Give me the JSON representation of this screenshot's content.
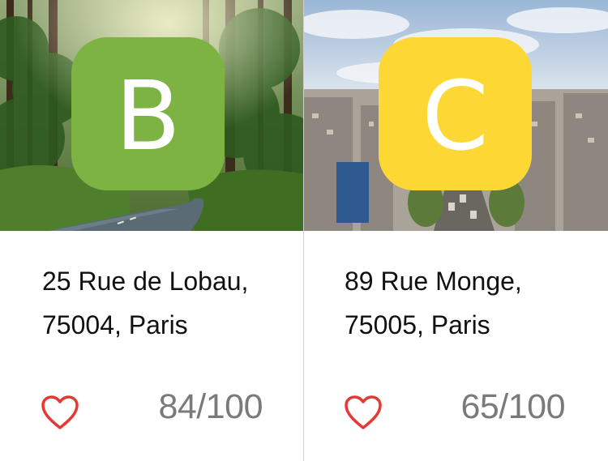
{
  "colors": {
    "grade_b": "#7cb342",
    "grade_c": "#fdd835",
    "heart": "#e53935",
    "score_text": "#7a7a7a",
    "divider": "#cfcfcf"
  },
  "cards": [
    {
      "grade": "B",
      "address_line1": "25 Rue de Lobau,",
      "address_line2": "75004, Paris",
      "score": "84/100",
      "favorite_icon": "heart-outline-icon"
    },
    {
      "grade": "C",
      "address_line1": "89 Rue Monge,",
      "address_line2": "75005, Paris",
      "score": "65/100",
      "favorite_icon": "heart-outline-icon"
    }
  ]
}
